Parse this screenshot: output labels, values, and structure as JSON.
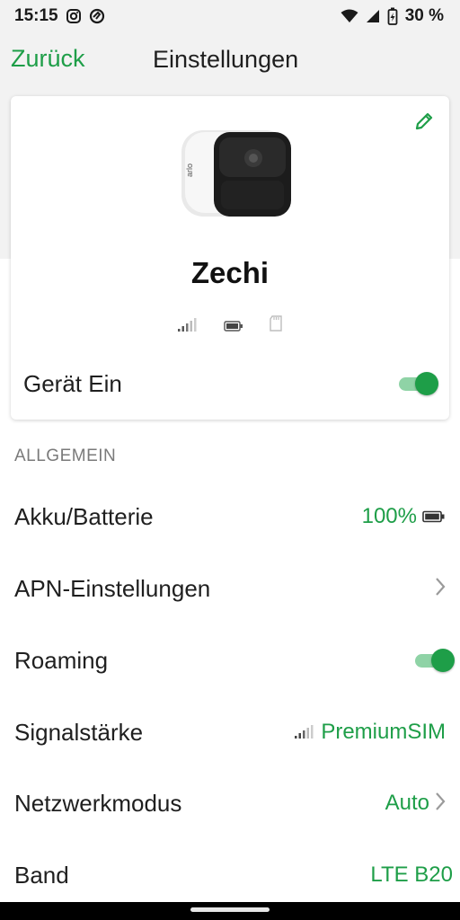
{
  "status_bar": {
    "time": "15:15",
    "battery_percent": "30 %",
    "icons": [
      "instagram-icon",
      "at-sign-icon",
      "wifi-icon",
      "signal-icon",
      "battery-charging-icon"
    ]
  },
  "nav": {
    "back_label": "Zurück",
    "title": "Einstellungen"
  },
  "device_card": {
    "camera_brand": "arlo",
    "name": "Zechi",
    "status_icons": [
      "signal-bars-icon",
      "battery-icon",
      "sd-card-icon"
    ],
    "power_label": "Gerät Ein",
    "power_on": true
  },
  "general": {
    "section_title": "ALLGEMEIN",
    "rows": [
      {
        "label": "Akku/Batterie",
        "value": "100%",
        "icon": "battery-icon"
      },
      {
        "label": "APN-Einstellungen",
        "value": "",
        "icon": "chevron-right-icon"
      },
      {
        "label": "Roaming",
        "toggle_on": true
      },
      {
        "label": "Signalstärke",
        "value": "PremiumSIM",
        "icon": "signal-bars-icon"
      },
      {
        "label": "Netzwerkmodus",
        "value": "Auto",
        "icon": "chevron-right-icon"
      },
      {
        "label": "Band",
        "value": "LTE B20"
      }
    ]
  },
  "colors": {
    "accent": "#1e9e48",
    "toggle_track": "#8fd3a6",
    "background_gray": "#f2f2f2",
    "section_text": "#7a7a7a"
  }
}
